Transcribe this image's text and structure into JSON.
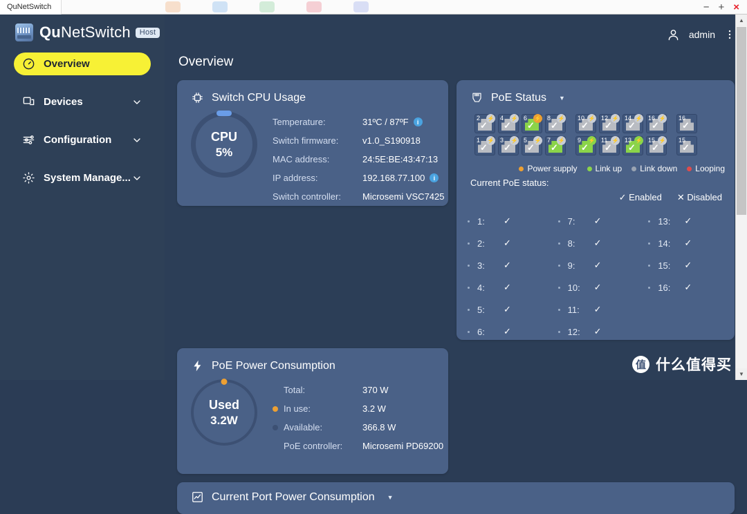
{
  "window": {
    "tab_title": "QuNetSwitch",
    "controls": {
      "minimize": "−",
      "maximize": "+",
      "close": "×"
    }
  },
  "sidebar": {
    "brand_bold": "Qu",
    "brand_rest": "NetSwitch",
    "host_badge": "Host",
    "items": [
      {
        "label": "Overview",
        "icon": "gauge-icon",
        "active": true,
        "chevron": false
      },
      {
        "label": "Devices",
        "icon": "devices-icon",
        "active": false,
        "chevron": true
      },
      {
        "label": "Configuration",
        "icon": "sliders-icon",
        "active": false,
        "chevron": true
      },
      {
        "label": "System Manage...",
        "icon": "gear-icon",
        "active": false,
        "chevron": true
      }
    ]
  },
  "header": {
    "user": "admin",
    "page_title": "Overview"
  },
  "cpu_card": {
    "title": "Switch CPU Usage",
    "icon": "cpu-chip-icon",
    "gauge_label": "CPU",
    "gauge_value": "5%",
    "gauge_percent": 5,
    "rows": [
      {
        "key": "Temperature:",
        "value": "31ºC / 87ºF",
        "info": true
      },
      {
        "key": "Switch firmware:",
        "value": "v1.0_S190918",
        "info": false
      },
      {
        "key": "MAC address:",
        "value": "24:5E:BE:43:47:13",
        "info": false
      },
      {
        "key": "IP address:",
        "value": "192.168.77.100",
        "info": true
      },
      {
        "key": "Switch controller:",
        "value": "Microsemi VSC7425",
        "info": false
      }
    ]
  },
  "poe_power_card": {
    "title": "PoE Power Consumption",
    "icon": "bolt-icon",
    "gauge_label": "Used",
    "gauge_value": "3.2W",
    "rows": [
      {
        "key": "Total:",
        "value": "370 W",
        "dot": ""
      },
      {
        "key": "In use:",
        "value": "3.2 W",
        "dot": "#eda033"
      },
      {
        "key": "Available:",
        "value": "366.8 W",
        "dot": "#3c5073"
      },
      {
        "key": "PoE controller:",
        "value": "Microsemi PD69200",
        "dot": ""
      }
    ]
  },
  "poe_status_card": {
    "title": "PoE Status",
    "icon": "rj45-icon",
    "ports_top": [
      {
        "num": "2",
        "link": "down",
        "badge": "bolt"
      },
      {
        "num": "4",
        "link": "down",
        "badge": "bolt"
      },
      {
        "num": "6",
        "link": "up",
        "badge": "power"
      },
      {
        "num": "8",
        "link": "down",
        "badge": "bolt"
      },
      {
        "num": "10",
        "link": "down",
        "badge": "bolt"
      },
      {
        "num": "12",
        "link": "down",
        "badge": "bolt"
      },
      {
        "num": "14",
        "link": "down",
        "badge": "bolt"
      },
      {
        "num": "16",
        "link": "down",
        "badge": "bolt"
      },
      {
        "num": "16",
        "link": "down",
        "badge": "none"
      }
    ],
    "ports_bottom": [
      {
        "num": "1",
        "link": "down",
        "badge": "bolt"
      },
      {
        "num": "3",
        "link": "down",
        "badge": "bolt"
      },
      {
        "num": "5",
        "link": "down",
        "badge": "bolt"
      },
      {
        "num": "7",
        "link": "up",
        "badge": "bolt"
      },
      {
        "num": "9",
        "link": "up",
        "badge": "bolt-green"
      },
      {
        "num": "11",
        "link": "down",
        "badge": "bolt"
      },
      {
        "num": "13",
        "link": "up",
        "badge": "bolt-green"
      },
      {
        "num": "15",
        "link": "down",
        "badge": "bolt"
      },
      {
        "num": "15",
        "link": "down",
        "badge": "none"
      }
    ],
    "legend": [
      {
        "label": "Power supply",
        "color": "#eda033"
      },
      {
        "label": "Link up",
        "color": "#8bd44a"
      },
      {
        "label": "Link down",
        "color": "#9aa4b3"
      },
      {
        "label": "Looping",
        "color": "#e04b4b"
      }
    ],
    "current_status_label": "Current PoE status:",
    "key_enabled": "Enabled",
    "key_disabled": "Disabled",
    "port_status": [
      {
        "num": "1:",
        "state": "enabled"
      },
      {
        "num": "7:",
        "state": "enabled"
      },
      {
        "num": "13:",
        "state": "enabled"
      },
      {
        "num": "2:",
        "state": "enabled"
      },
      {
        "num": "8:",
        "state": "enabled"
      },
      {
        "num": "14:",
        "state": "enabled"
      },
      {
        "num": "3:",
        "state": "enabled"
      },
      {
        "num": "9:",
        "state": "enabled"
      },
      {
        "num": "15:",
        "state": "enabled"
      },
      {
        "num": "4:",
        "state": "enabled"
      },
      {
        "num": "10:",
        "state": "enabled"
      },
      {
        "num": "16:",
        "state": "enabled"
      },
      {
        "num": "5:",
        "state": "enabled"
      },
      {
        "num": "11:",
        "state": "enabled"
      },
      {
        "num": "",
        "state": "none"
      },
      {
        "num": "6:",
        "state": "enabled"
      },
      {
        "num": "12:",
        "state": "enabled"
      },
      {
        "num": "",
        "state": "none"
      }
    ]
  },
  "port_power_card": {
    "title": "Current Port Power Consumption",
    "icon": "chart-icon"
  },
  "watermark": {
    "logo": "值",
    "text": "什么值得买"
  },
  "colors": {
    "accent_yellow": "#f7f135",
    "card": "#4a6187",
    "sidebar": "#2e4057",
    "link_up": "#8bd44a",
    "power": "#eda033"
  }
}
